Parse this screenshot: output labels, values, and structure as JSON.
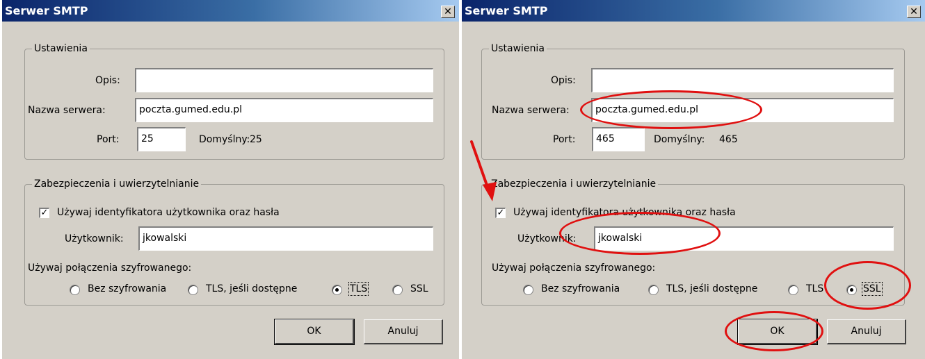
{
  "left": {
    "title": "Serwer SMTP",
    "close": "✕",
    "settings": {
      "legend": "Ustawienia",
      "desc_label": "Opis:",
      "desc_value": "",
      "server_label": "Nazwa serwera:",
      "server_value": "poczta.gumed.edu.pl",
      "port_label": "Port:",
      "port_value": "25",
      "default_label": "Domyślny:",
      "default_value": "25"
    },
    "security": {
      "legend": "Zabezpieczenia i uwierzytelnianie",
      "use_auth_label": "Używaj identyfikatora użytkownika oraz hasła",
      "use_auth_checked": true,
      "user_label": "Użytkownik:",
      "user_value": "jkowalski",
      "encrypt_label": "Używaj połączenia szyfrowanego:",
      "options": [
        "Bez szyfrowania",
        "TLS, jeśli dostępne",
        "TLS",
        "SSL"
      ],
      "selected": "TLS"
    },
    "ok": "OK",
    "cancel": "Anuluj"
  },
  "right": {
    "title": "Serwer SMTP",
    "close": "✕",
    "settings": {
      "legend": "Ustawienia",
      "desc_label": "Opis:",
      "desc_value": "",
      "server_label": "Nazwa serwera:",
      "server_value": "poczta.gumed.edu.pl",
      "port_label": "Port:",
      "port_value": "465",
      "default_label": "Domyślny:",
      "default_value": "465"
    },
    "security": {
      "legend": "Zabezpieczenia i uwierzytelnianie",
      "use_auth_label": "Używaj identyfikatora użytkownika oraz hasła",
      "use_auth_checked": true,
      "user_label": "Użytkownik:",
      "user_value": "jkowalski",
      "encrypt_label": "Używaj połączenia szyfrowanego:",
      "options": [
        "Bez szyfrowania",
        "TLS, jeśli dostępne",
        "TLS",
        "SSL"
      ],
      "selected": "SSL"
    },
    "ok": "OK",
    "cancel": "Anuluj"
  },
  "colors": {
    "title_bar": "#0a246a",
    "dialog_bg": "#d4d0c8",
    "annotation": "#e01010"
  },
  "icons": {
    "close": "close-icon",
    "check": "checkmark-icon",
    "arrow": "red-arrow-annotation"
  }
}
